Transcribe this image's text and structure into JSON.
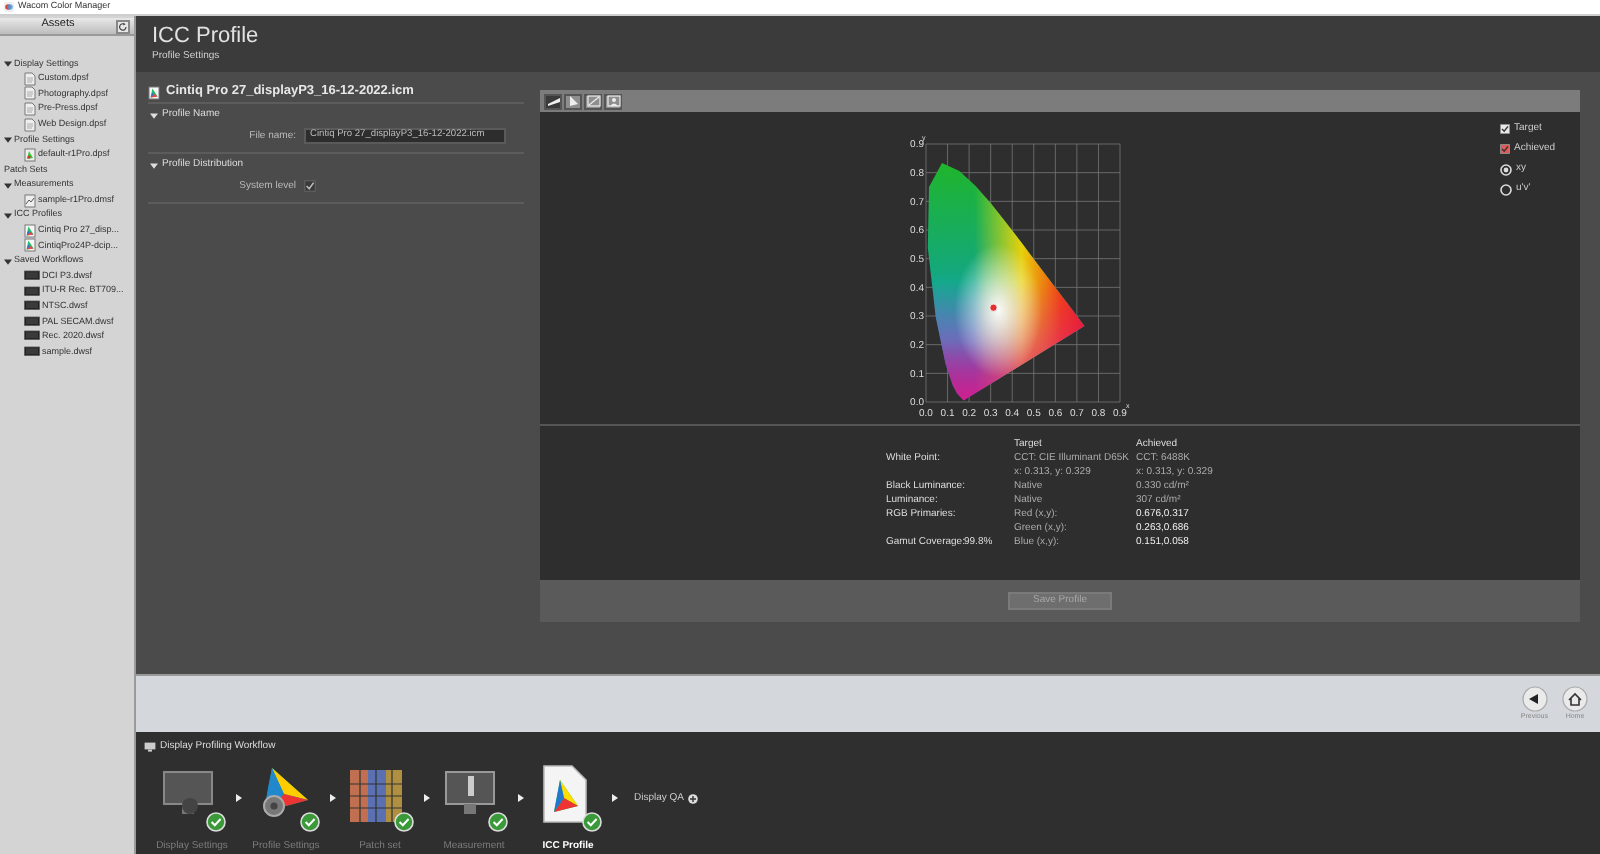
{
  "window": {
    "title": "Wacom Color Manager"
  },
  "sidebar": {
    "title": "Assets",
    "tree": [
      {
        "label": "Display Settings",
        "expanded": true,
        "children": [
          {
            "label": "Custom.dpsf",
            "kind": "settings"
          },
          {
            "label": "Photography.dpsf",
            "kind": "settings"
          },
          {
            "label": "Pre-Press.dpsf",
            "kind": "settings"
          },
          {
            "label": "Web Design.dpsf",
            "kind": "settings"
          }
        ]
      },
      {
        "label": "Profile Settings",
        "expanded": true,
        "children": [
          {
            "label": "default-r1Pro.dpsf",
            "kind": "profile"
          }
        ]
      },
      {
        "label": "Patch Sets"
      },
      {
        "label": "Measurements",
        "expanded": true,
        "children": [
          {
            "label": "sample-r1Pro.dmsf",
            "kind": "measurement"
          }
        ]
      },
      {
        "label": "ICC Profiles",
        "expanded": true,
        "children": [
          {
            "label": "Cintiq Pro 27_disp...",
            "kind": "icc"
          },
          {
            "label": "CintiqPro24P-dcip...",
            "kind": "icc"
          }
        ]
      },
      {
        "label": "Saved Workflows",
        "expanded": true,
        "children": [
          {
            "label": "DCI P3.dwsf",
            "kind": "workflow"
          },
          {
            "label": "ITU-R Rec. BT709...",
            "kind": "workflow"
          },
          {
            "label": "NTSC.dwsf",
            "kind": "workflow"
          },
          {
            "label": "PAL SECAM.dwsf",
            "kind": "workflow"
          },
          {
            "label": "Rec. 2020.dwsf",
            "kind": "workflow"
          },
          {
            "label": "sample.dwsf",
            "kind": "workflow"
          }
        ]
      }
    ]
  },
  "header": {
    "title": "ICC Profile",
    "subtitle": "Profile Settings"
  },
  "profile": {
    "file": "Cintiq Pro 27_displayP3_16-12-2022.icm",
    "sections": [
      {
        "title": "Profile Name",
        "expanded": true,
        "fields": [
          {
            "kind": "text",
            "label": "File name:",
            "value": "Cintiq Pro 27_displayP3_16-12-2022.icm"
          }
        ]
      },
      {
        "title": "Profile Distribution",
        "expanded": true,
        "fields": [
          {
            "kind": "checkbox",
            "label": "System level",
            "checked": true
          }
        ]
      }
    ]
  },
  "viewer": {
    "tabs": [
      {
        "selected": true
      },
      {
        "selected": false
      },
      {
        "selected": false
      },
      {
        "selected": false
      }
    ],
    "legend": [
      {
        "kind": "checkbox",
        "label": "Target",
        "checked": true
      },
      {
        "kind": "checkbox",
        "label": "Achieved",
        "checked": true
      },
      {
        "kind": "radio",
        "label": "xy",
        "selected": true
      },
      {
        "kind": "radio",
        "label": "u'v'",
        "selected": false
      }
    ],
    "diagram": {
      "x_axis": "x",
      "y_axis": "y",
      "x_ticks": [
        "0.0",
        "0.1",
        "0.2",
        "0.3",
        "0.4",
        "0.5",
        "0.6",
        "0.7",
        "0.8",
        "0.9"
      ],
      "y_ticks": [
        "0.9",
        "0.8",
        "0.7",
        "0.6",
        "0.5",
        "0.4",
        "0.3",
        "0.2",
        "0.1",
        "0.0"
      ]
    }
  },
  "results": {
    "columns": [
      "Target",
      "Achieved"
    ],
    "rows": [
      {
        "label": "White Point:",
        "target": "CCT: CIE Illuminant D65K",
        "achieved": "CCT: 6488K",
        "strong": false
      },
      {
        "target": "x: 0.313, y: 0.329",
        "achieved": "x: 0.313, y: 0.329",
        "strong": false
      },
      {
        "label": "Black Luminance:",
        "target": "Native",
        "achieved": "0.330 cd/m²",
        "strong": false
      },
      {
        "label": "Luminance:",
        "target": "Native",
        "achieved": "307 cd/m²",
        "strong": false
      },
      {
        "label": "RGB Primaries:",
        "target": "Red (x,y):",
        "achieved": "0.676,0.317",
        "strong": true
      },
      {
        "target": "Green (x,y):",
        "achieved": "0.263,0.686",
        "strong": true
      },
      {
        "label": "Gamut Coverage:",
        "coverage": "99.8%",
        "target": "Blue (x,y):",
        "achieved": "0.151,0.058",
        "strong": true
      }
    ]
  },
  "save_button": {
    "label": "Save Profile",
    "disabled": true
  },
  "nav": [
    {
      "label": "Previous"
    },
    {
      "label": "Home"
    }
  ],
  "workflow": {
    "title": "Display Profiling Workflow",
    "steps": [
      {
        "label": "Display Settings",
        "done": true,
        "selected": false
      },
      {
        "label": "Profile Settings",
        "done": true,
        "selected": false
      },
      {
        "label": "Patch set",
        "done": true,
        "selected": false
      },
      {
        "label": "Measurement",
        "done": true,
        "selected": false
      },
      {
        "label": "ICC Profile",
        "done": true,
        "selected": true
      }
    ],
    "extra": "Display QA"
  }
}
